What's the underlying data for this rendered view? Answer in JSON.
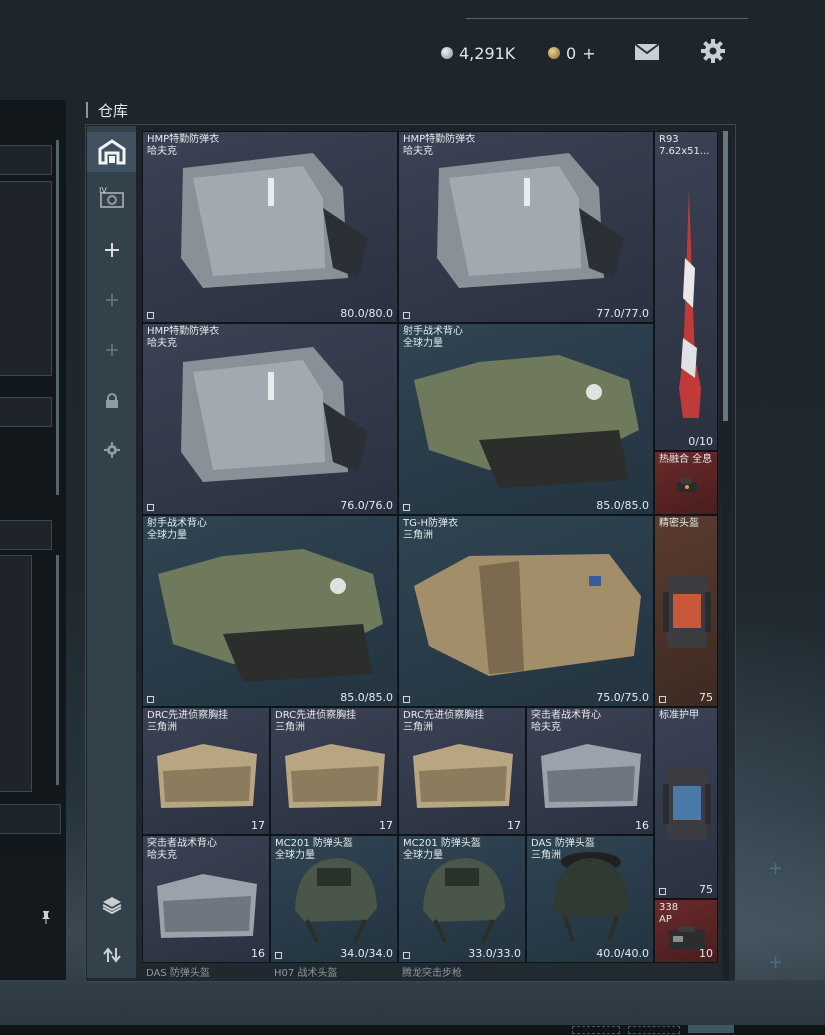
{
  "header": {
    "silver_amount": "4,291K",
    "gold_amount": "0",
    "gold_add": "+"
  },
  "warehouse": {
    "title": "仓库"
  },
  "sidebar": {
    "items": [
      {
        "icon": "warehouse-icon",
        "active": true
      },
      {
        "icon": "expansion-case-icon",
        "badge": "IV"
      },
      {
        "icon": "plus-icon"
      },
      {
        "icon": "plus-icon-dim"
      },
      {
        "icon": "plus-icon-dim"
      },
      {
        "icon": "lock-icon"
      },
      {
        "icon": "settings-icon"
      },
      {
        "icon": "layers-icon"
      },
      {
        "icon": "transfer-icon"
      }
    ]
  },
  "items": [
    {
      "name": "HMP特勤防弹衣",
      "sub": "哈夫克",
      "durability": "80.0/80.0"
    },
    {
      "name": "HMP特勤防弹衣",
      "sub": "哈夫克",
      "durability": "77.0/77.0"
    },
    {
      "name": "R93",
      "sub": "7.62x51...",
      "durability": "0/10"
    },
    {
      "name": "HMP特勤防弹衣",
      "sub": "哈夫克",
      "durability": "76.0/76.0"
    },
    {
      "name": "射手战术背心",
      "sub": "全球力量",
      "durability": "85.0/85.0"
    },
    {
      "name": "热融合 全息",
      "sub": ""
    },
    {
      "name": "射手战术背心",
      "sub": "全球力量",
      "durability": "85.0/85.0"
    },
    {
      "name": "TG-H防弹衣",
      "sub": "三角洲",
      "durability": "75.0/75.0"
    },
    {
      "name": "精密头盔",
      "sub": "",
      "durability": "75"
    },
    {
      "name": "DRC先进侦察胸挂",
      "sub": "三角洲",
      "capacity": "17"
    },
    {
      "name": "DRC先进侦察胸挂",
      "sub": "三角洲",
      "capacity": "17"
    },
    {
      "name": "DRC先进侦察胸挂",
      "sub": "三角洲",
      "capacity": "17"
    },
    {
      "name": "突击者战术背心",
      "sub": "哈夫克",
      "capacity": "16"
    },
    {
      "name": "标准护甲",
      "sub": "",
      "durability": "75"
    },
    {
      "name": "突击者战术背心",
      "sub": "哈夫克",
      "capacity": "16"
    },
    {
      "name": "MC201 防弹头盔",
      "sub": "全球力量",
      "durability": "34.0/34.0"
    },
    {
      "name": "MC201 防弹头盔",
      "sub": "全球力量",
      "durability": "33.0/33.0"
    },
    {
      "name": "DAS 防弹头盔",
      "sub": "三角洲",
      "durability": "40.0/40.0"
    },
    {
      "name": "338",
      "sub": "AP",
      "count": "10"
    }
  ],
  "next_row": [
    "DAS 防弹头盔",
    "H07 战术头盔",
    "腾龙突击步枪"
  ]
}
